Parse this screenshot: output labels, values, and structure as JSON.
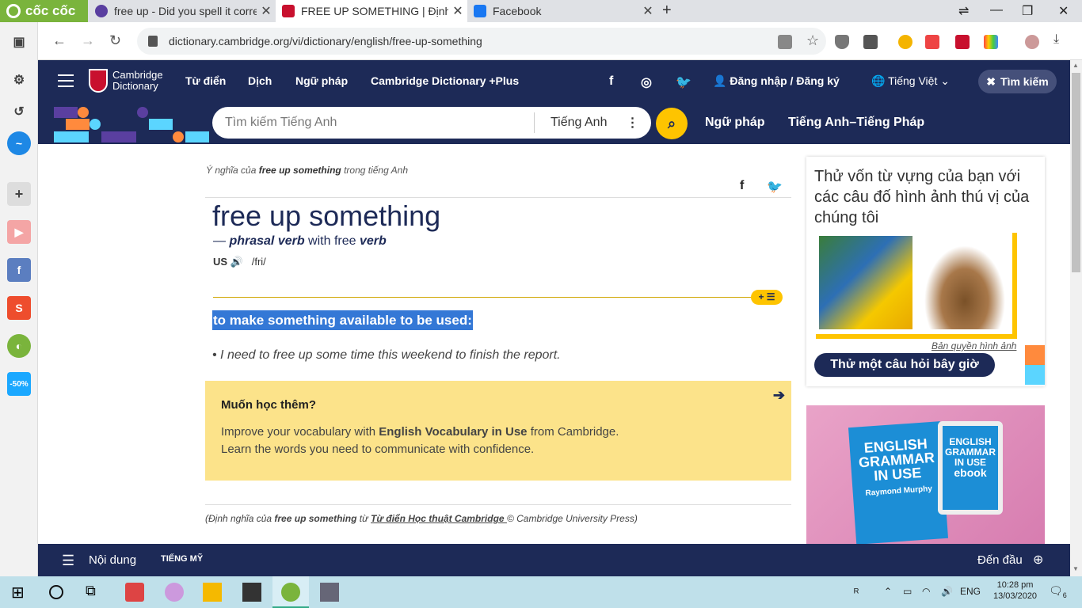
{
  "browser": {
    "logo": "cốc cốc",
    "tabs": [
      {
        "label": "free up - Did you spell it corre",
        "color": "#5a3fa0",
        "active": false
      },
      {
        "label": "FREE UP SOMETHING | Định n",
        "color": "#c8102e",
        "active": true
      },
      {
        "label": "Facebook",
        "color": "#1877f2",
        "active": false
      }
    ],
    "url": "dictionary.cambridge.org/vi/dictionary/english/free-up-something"
  },
  "header": {
    "logo_line1": "Cambridge",
    "logo_line2": "Dictionary",
    "nav": [
      "Từ điển",
      "Dịch",
      "Ngữ pháp",
      "Cambridge Dictionary +Plus"
    ],
    "login": "Đăng nhập / Đăng ký",
    "language": "Tiếng Việt",
    "search_button": "Tìm kiếm"
  },
  "search": {
    "placeholder": "Tìm kiếm Tiếng Anh",
    "dictionary": "Tiếng Anh",
    "links": [
      "Ngữ pháp",
      "Tiếng Anh–Tiếng Pháp"
    ]
  },
  "entry": {
    "breadcrumb_pre": "Ý nghĩa của ",
    "breadcrumb_word": "free up something",
    "breadcrumb_post": " trong tiếng Anh",
    "headword": "free up something",
    "pos_dash": "— ",
    "pos": "phrasal verb",
    "pos_with": " with free ",
    "pos_verb": "verb",
    "region": "US",
    "ipa": "/fri/",
    "definition": "to make something available to be used:",
    "example": "I need to free up some time this weekend to finish the report."
  },
  "promo": {
    "title": "Muốn học thêm?",
    "line1_pre": "Improve your vocabulary with ",
    "line1_bold": "English Vocabulary in Use",
    "line1_post": " from Cambridge.",
    "line2": "Learn the words you need to communicate with confidence."
  },
  "credit": {
    "pre": "(Định nghĩa của ",
    "word": "free up something",
    "mid": " từ ",
    "source": "Từ điển Học thuật Cambridge ",
    "post": "© Cambridge University Press)"
  },
  "quiz": {
    "question": "Thử vốn từ vựng của bạn với các câu đố hình ảnh thú vị của chúng tôi",
    "copyright": "Bản quyền hình ảnh",
    "button": "Thử một câu hỏi bây giờ"
  },
  "ad": {
    "book_title": "ENGLISH GRAMMAR IN USE",
    "book_author": "Raymond Murphy",
    "tablet_title": "ENGLISH GRAMMAR IN USE",
    "tablet_sub": "ebook"
  },
  "bottombar": {
    "contents": "Nội dung",
    "region": "TIẾNG MỸ",
    "top": "Đến đầu"
  },
  "taskbar": {
    "lang": "ENG",
    "time": "10:28 pm",
    "date": "13/03/2020",
    "notifications": "6"
  },
  "colors": {
    "navy": "#1d2a57",
    "yellow": "#fec400",
    "highlight": "#3478d6"
  }
}
